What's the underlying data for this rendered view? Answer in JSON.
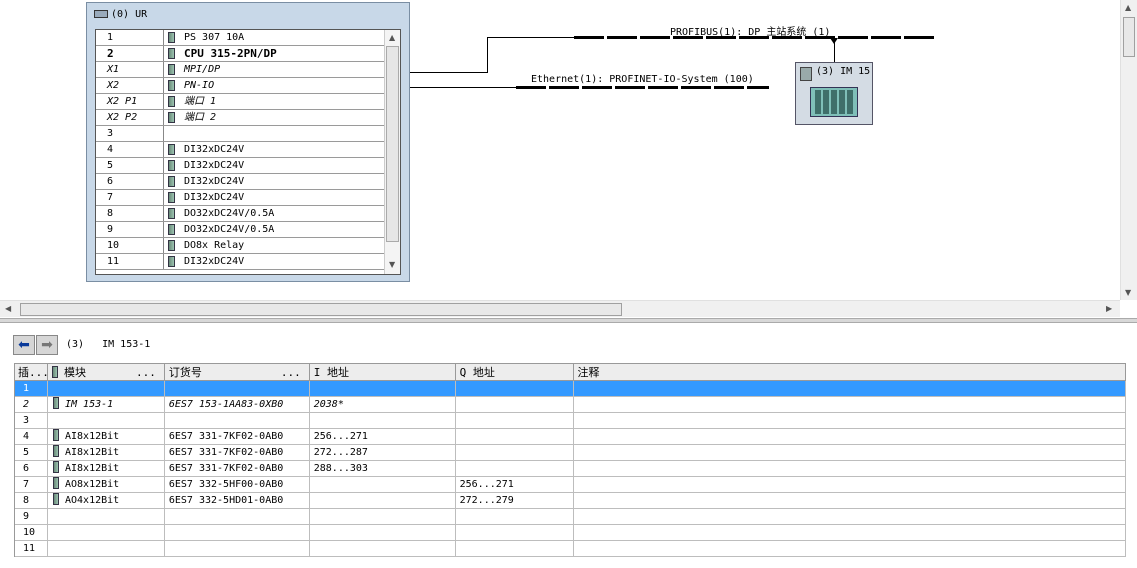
{
  "rack": {
    "title": "(0) UR",
    "rows": [
      {
        "slot": "1",
        "module": "PS 307 10A"
      },
      {
        "slot": "2",
        "module": "CPU 315-2PN/DP"
      },
      {
        "slot": "X1",
        "module": "MPI/DP"
      },
      {
        "slot": "X2",
        "module": "PN-IO"
      },
      {
        "slot": "X2 P1",
        "module": "端口 1"
      },
      {
        "slot": "X2 P2",
        "module": "端口 2"
      },
      {
        "slot": "3",
        "module": ""
      },
      {
        "slot": "4",
        "module": "DI32xDC24V"
      },
      {
        "slot": "5",
        "module": "DI32xDC24V"
      },
      {
        "slot": "6",
        "module": "DI32xDC24V"
      },
      {
        "slot": "7",
        "module": "DI32xDC24V"
      },
      {
        "slot": "8",
        "module": "DO32xDC24V/0.5A"
      },
      {
        "slot": "9",
        "module": "DO32xDC24V/0.5A"
      },
      {
        "slot": "10",
        "module": "DO8x Relay"
      },
      {
        "slot": "11",
        "module": "DI32xDC24V"
      }
    ]
  },
  "networks": {
    "profibus": "PROFIBUS(1): DP 主站系统 (1)",
    "ethernet": "Ethernet(1): PROFINET-IO-System (100)"
  },
  "device": {
    "label": "(3) IM 15"
  },
  "detail": {
    "title": "(3)   IM 153-1",
    "columns": [
      "插...",
      "模块",
      "订货号",
      "I 地址",
      "Q 地址",
      "注释"
    ],
    "rows": [
      {
        "slot": "1",
        "module": "",
        "order": "",
        "i": "",
        "q": "",
        "comment": ""
      },
      {
        "slot": "2",
        "module": "IM 153-1",
        "order": "6ES7 153-1AA83-0XB0",
        "i": "2038*",
        "q": "",
        "comment": ""
      },
      {
        "slot": "3",
        "module": "",
        "order": "",
        "i": "",
        "q": "",
        "comment": ""
      },
      {
        "slot": "4",
        "module": "AI8x12Bit",
        "order": "6ES7 331-7KF02-0AB0",
        "i": "256...271",
        "q": "",
        "comment": ""
      },
      {
        "slot": "5",
        "module": "AI8x12Bit",
        "order": "6ES7 331-7KF02-0AB0",
        "i": "272...287",
        "q": "",
        "comment": ""
      },
      {
        "slot": "6",
        "module": "AI8x12Bit",
        "order": "6ES7 331-7KF02-0AB0",
        "i": "288...303",
        "q": "",
        "comment": ""
      },
      {
        "slot": "7",
        "module": "AO8x12Bit",
        "order": "6ES7 332-5HF00-0AB0",
        "i": "",
        "q": "256...271",
        "comment": ""
      },
      {
        "slot": "8",
        "module": "AO4x12Bit",
        "order": "6ES7 332-5HD01-0AB0",
        "i": "",
        "q": "272...279",
        "comment": ""
      },
      {
        "slot": "9",
        "module": "",
        "order": "",
        "i": "",
        "q": "",
        "comment": ""
      },
      {
        "slot": "10",
        "module": "",
        "order": "",
        "i": "",
        "q": "",
        "comment": ""
      },
      {
        "slot": "11",
        "module": "",
        "order": "",
        "i": "",
        "q": "",
        "comment": ""
      }
    ]
  },
  "colors": {
    "selection": "#3399ff",
    "rack_bg": "#c8d8e8"
  }
}
